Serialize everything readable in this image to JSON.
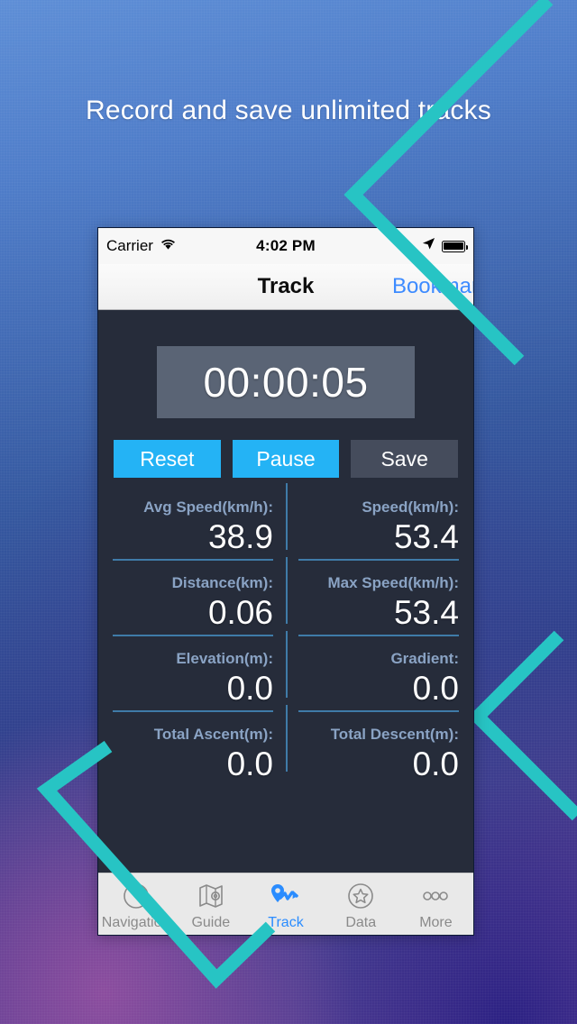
{
  "promo": {
    "headline": "Record and save unlimited tracks",
    "bg_top_color": "#5e8ed6",
    "bg_bottom_left_color": "#7b4391",
    "bg_bottom_right_color": "#2b2183",
    "chevron_color": "#27c4c4"
  },
  "status_bar": {
    "carrier": "Carrier",
    "time": "4:02 PM",
    "wifi_icon": "wifi-icon",
    "location_icon": "location-arrow-icon",
    "battery_icon": "battery-full-icon"
  },
  "nav_bar": {
    "title": "Track",
    "right_action": "Bookmark",
    "right_action_color": "#3d8bff"
  },
  "timer": {
    "value": "00:00:05",
    "panel_color": "#5a6475"
  },
  "buttons": [
    {
      "label": "Reset",
      "style": "blue",
      "color": "#24b3f5"
    },
    {
      "label": "Pause",
      "style": "blue",
      "color": "#24b3f5"
    },
    {
      "label": "Save",
      "style": "gray",
      "color": "#454c5c"
    }
  ],
  "stats": {
    "rows": [
      {
        "left": {
          "label": "Avg Speed(km/h):",
          "value": "38.9",
          "underline": true
        },
        "right": {
          "label": "Speed(km/h):",
          "value": "53.4",
          "underline": true
        }
      },
      {
        "left": {
          "label": "Distance(km):",
          "value": "0.06",
          "underline": true
        },
        "right": {
          "label": "Max Speed(km/h):",
          "value": "53.4",
          "underline": true
        }
      },
      {
        "left": {
          "label": "Elevation(m):",
          "value": "0.0",
          "underline": true
        },
        "right": {
          "label": "Gradient:",
          "value": "0.0",
          "underline": true
        }
      },
      {
        "left": {
          "label": "Total Ascent(m):",
          "value": "0.0",
          "underline": false
        },
        "right": {
          "label": "Total Descent(m):",
          "value": "0.0",
          "underline": false
        }
      }
    ],
    "label_color": "#8aa3c4",
    "underline_color": "#3f7ba8"
  },
  "tab_bar": {
    "active_color": "#2a8cff",
    "inactive_color": "#8a8a8a",
    "items": [
      {
        "label": "Navigation",
        "icon": "compass-icon",
        "active": false
      },
      {
        "label": "Guide",
        "icon": "map-icon",
        "active": false
      },
      {
        "label": "Track",
        "icon": "route-pin-icon",
        "active": true
      },
      {
        "label": "Data",
        "icon": "star-circle-icon",
        "active": false
      },
      {
        "label": "More",
        "icon": "ellipsis-icon",
        "active": false
      }
    ]
  }
}
